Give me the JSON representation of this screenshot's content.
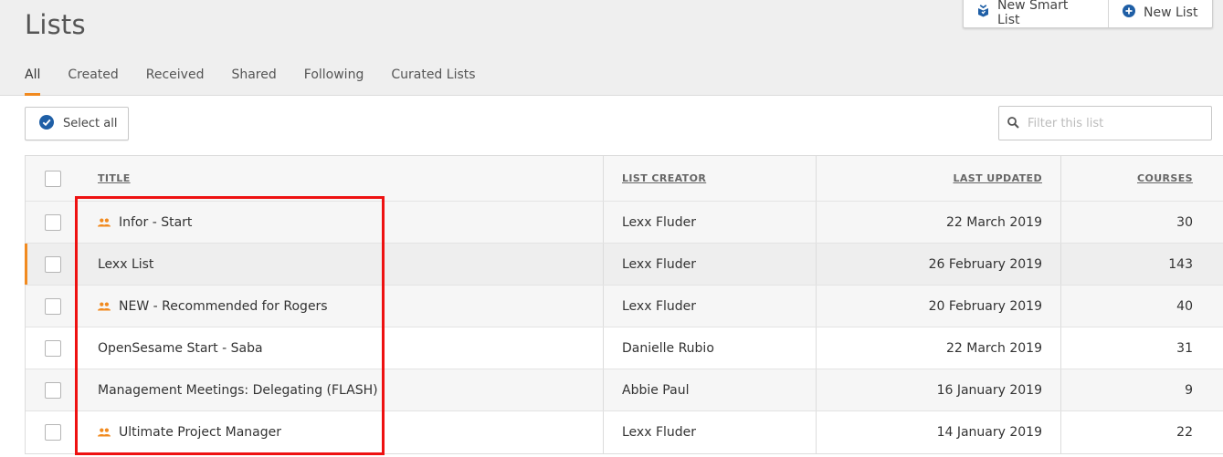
{
  "page": {
    "title": "Lists"
  },
  "actions": {
    "new_smart_list": "New Smart List",
    "new_list": "New List"
  },
  "tabs": [
    "All",
    "Created",
    "Received",
    "Shared",
    "Following",
    "Curated Lists"
  ],
  "toolbar": {
    "select_all": "Select all",
    "filter_placeholder": "Filter this list"
  },
  "table": {
    "columns": {
      "title": "TITLE",
      "creator": "LIST CREATOR",
      "updated": "LAST UPDATED",
      "courses": "COURSES"
    },
    "rows": [
      {
        "title": "Infor - Start",
        "shared": true,
        "creator": "Lexx Fluder",
        "updated": "22 March 2019",
        "courses": "30"
      },
      {
        "title": "Lexx List",
        "shared": false,
        "creator": "Lexx Fluder",
        "updated": "26 February 2019",
        "courses": "143"
      },
      {
        "title": "NEW - Recommended for Rogers",
        "shared": true,
        "creator": "Lexx Fluder",
        "updated": "20 February 2019",
        "courses": "40"
      },
      {
        "title": "OpenSesame Start - Saba",
        "shared": false,
        "creator": "Danielle Rubio",
        "updated": "22 March 2019",
        "courses": "31"
      },
      {
        "title": "Management Meetings: Delegating (FLASH)",
        "shared": false,
        "creator": "Abbie Paul",
        "updated": "16 January 2019",
        "courses": "9"
      },
      {
        "title": "Ultimate Project Manager",
        "shared": true,
        "creator": "Lexx Fluder",
        "updated": "14 January 2019",
        "courses": "22"
      }
    ]
  },
  "colors": {
    "accent": "#f18a1f",
    "brand_blue": "#1f5fa6",
    "annotation": "#ee1111"
  },
  "icons": {
    "smart_list": "smart-list-icon",
    "new_list": "plus-circle-icon",
    "select_all": "check-circle-icon",
    "filter": "search-icon",
    "shared": "people-icon"
  }
}
